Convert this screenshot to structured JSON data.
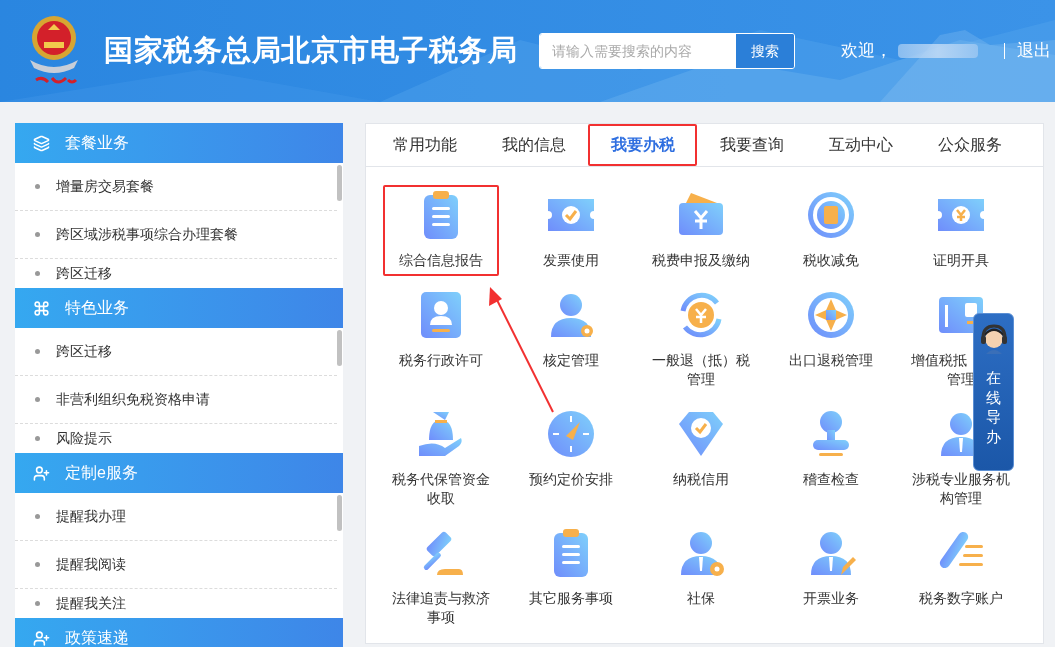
{
  "header": {
    "title": "国家税务总局北京市电子税务局",
    "search": {
      "placeholder": "请输入需要搜索的内容",
      "button": "搜索"
    },
    "welcome": "欢迎，",
    "logout": "退出"
  },
  "sidebar": {
    "sections": [
      {
        "title": "套餐业务",
        "items": [
          "增量房交易套餐",
          "跨区域涉税事项综合办理套餐",
          "跨区迁移"
        ]
      },
      {
        "title": "特色业务",
        "items": [
          "跨区迁移",
          "非营利组织免税资格申请",
          "风险提示"
        ]
      },
      {
        "title": "定制e服务",
        "items": [
          "提醒我办理",
          "提醒我阅读",
          "提醒我关注"
        ]
      },
      {
        "title": "政策速递"
      }
    ]
  },
  "tabs": [
    {
      "label": "常用功能",
      "selected": false,
      "annotated": false
    },
    {
      "label": "我的信息",
      "selected": false,
      "annotated": false
    },
    {
      "label": "我要办税",
      "selected": true,
      "annotated": true
    },
    {
      "label": "我要查询",
      "selected": false,
      "annotated": false
    },
    {
      "label": "互动中心",
      "selected": false,
      "annotated": false
    },
    {
      "label": "公众服务",
      "selected": false,
      "annotated": false
    }
  ],
  "tiles": [
    {
      "lines": [
        "综合信息报告"
      ],
      "annotated": true
    },
    {
      "lines": [
        "发票使用"
      ],
      "annotated": false
    },
    {
      "lines": [
        "税费申报及缴纳"
      ],
      "annotated": false
    },
    {
      "lines": [
        "税收减免"
      ],
      "annotated": false
    },
    {
      "lines": [
        "证明开具"
      ],
      "annotated": false
    },
    {
      "lines": [
        "税务行政许可"
      ],
      "annotated": false
    },
    {
      "lines": [
        "核定管理"
      ],
      "annotated": false
    },
    {
      "lines": [
        "一般退（抵）税",
        "管理"
      ],
      "annotated": false
    },
    {
      "lines": [
        "出口退税管理"
      ],
      "annotated": false
    },
    {
      "lines": [
        "增值税抵",
        "管理"
      ],
      "annotated": false,
      "covered": true
    },
    {
      "lines": [
        "税务代保管资金",
        "收取"
      ],
      "annotated": false
    },
    {
      "lines": [
        "预约定价安排"
      ],
      "annotated": false
    },
    {
      "lines": [
        "纳税信用"
      ],
      "annotated": false
    },
    {
      "lines": [
        "稽查检查"
      ],
      "annotated": false
    },
    {
      "lines": [
        "涉税专业服务机",
        "构管理"
      ],
      "annotated": false
    },
    {
      "lines": [
        "法律追责与救济",
        "事项"
      ],
      "annotated": false
    },
    {
      "lines": [
        "其它服务事项"
      ],
      "annotated": false
    },
    {
      "lines": [
        "社保"
      ],
      "annotated": false
    },
    {
      "lines": [
        "开票业务"
      ],
      "annotated": false
    },
    {
      "lines": [
        "税务数字账户"
      ],
      "annotated": false
    }
  ],
  "online_guide": {
    "label": "在线导办"
  }
}
